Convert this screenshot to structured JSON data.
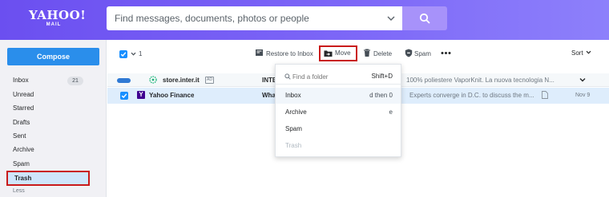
{
  "header": {
    "logo_line1": "YAHOO!",
    "logo_line2": "MAIL",
    "search_placeholder": "Find messages, documents, photos or people"
  },
  "sidebar": {
    "compose_label": "Compose",
    "folders": [
      {
        "label": "Inbox",
        "count": "21"
      },
      {
        "label": "Unread"
      },
      {
        "label": "Starred"
      },
      {
        "label": "Drafts"
      },
      {
        "label": "Sent"
      },
      {
        "label": "Archive"
      },
      {
        "label": "Spam"
      },
      {
        "label": "Trash",
        "selected": true
      }
    ],
    "less_label": "Less"
  },
  "toolbar": {
    "selected_count": "1",
    "restore_label": "Restore to Inbox",
    "move_label": "Move",
    "delete_label": "Delete",
    "spam_label": "Spam",
    "sort_label": "Sort"
  },
  "messages": [
    {
      "sender": "store.inter.it",
      "sender_tag": "AD",
      "subject": "INTE",
      "preview": "100% poliestere VaporKnit. La nuova tecnologia N...",
      "date": "",
      "is_ad": true,
      "selected": false
    },
    {
      "sender": "Yahoo Finance",
      "subject": "What",
      "preview": "Experts converge in D.C. to discuss the m...",
      "date": "Nov 9",
      "is_ad": false,
      "selected": true
    }
  ],
  "move_menu": {
    "search_placeholder": "Find a folder",
    "search_shortcut": "Shift+D",
    "items": [
      {
        "label": "Inbox",
        "shortcut": "d then 0",
        "enabled": true
      },
      {
        "label": "Archive",
        "shortcut": "e",
        "enabled": true
      },
      {
        "label": "Spam",
        "shortcut": "",
        "enabled": true
      },
      {
        "label": "Trash",
        "shortcut": "",
        "enabled": false
      }
    ]
  },
  "colors": {
    "header_gradient_start": "#6b4ff0",
    "header_gradient_end": "#8d80fb",
    "search_button": "#a792fa",
    "compose_button": "#2a8eeb",
    "selection_blue": "#188fff",
    "highlight_outline": "#c91a1a"
  }
}
